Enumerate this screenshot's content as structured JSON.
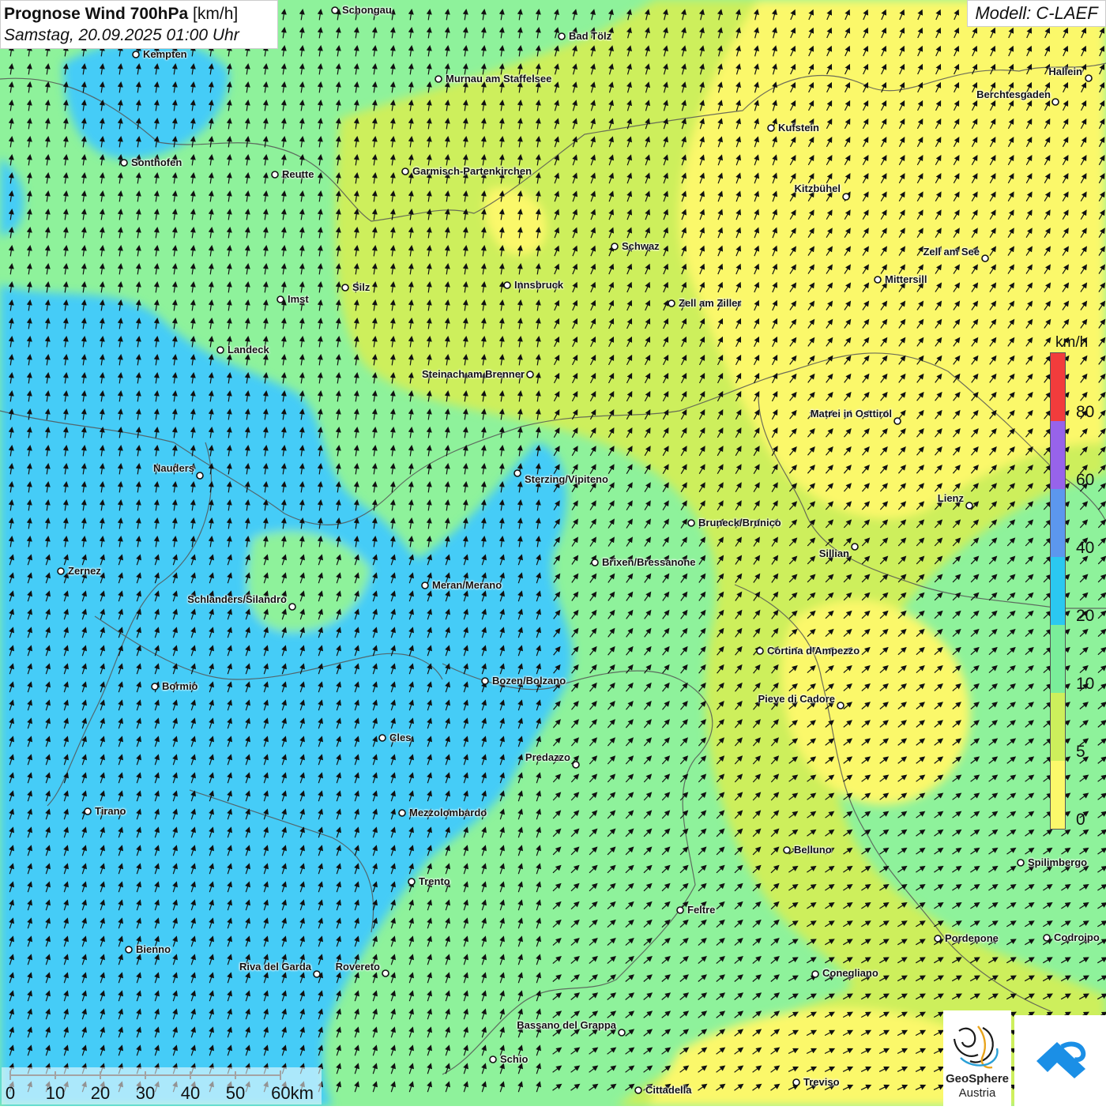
{
  "header": {
    "title_main": "Prognose Wind 700hPa",
    "title_unit": "[km/h]",
    "date_line": "Samstag, 20.09.2025 01:00 Uhr",
    "model": "Modell: C-LAEF"
  },
  "legend": {
    "unit": "km/h",
    "ticks": [
      "0",
      "5",
      "10",
      "20",
      "40",
      "60",
      "80"
    ],
    "colors": [
      "#fbf86b",
      "#cdef5c",
      "#7aed9a",
      "#2bc8f0",
      "#5c97ee",
      "#9763ea",
      "#f23c3c"
    ]
  },
  "scale_bar": {
    "labels": [
      "0",
      "10",
      "20",
      "30",
      "40",
      "50",
      "60km"
    ]
  },
  "logos": {
    "geosphere_line1": "GeoSphere",
    "geosphere_line2": "Austria"
  },
  "map_colors": {
    "low_0_5": "#fbf86b",
    "5_10": "#cdef5c",
    "10_20": "#8ef29b",
    "20_40": "#45ccf7",
    "border": "#555555"
  },
  "cities": [
    "Schongau",
    "Bad Tölz",
    "Kempten",
    "Murnau am Staffelsee",
    "Hallein",
    "Berchtesgaden",
    "Kufstein",
    "Sonthofen",
    "Reutte",
    "Garmisch-Partenkirchen",
    "Kitzbühel",
    "Schwaz",
    "Zell am See",
    "Mittersill",
    "Innsbruck",
    "Silz",
    "Imst",
    "Zell am Ziller",
    "Landeck",
    "Steinach am Brenner",
    "Matrei in Osttirol",
    "Nauders",
    "Sterzing/Vipiteno",
    "Lienz",
    "Bruneck/Brunico",
    "Sillian",
    "Brixen/Bressanone",
    "Zernez",
    "Meran/Merano",
    "Schlanders/Silandro",
    "Cortina d'Ampezzo",
    "Bozen/Bolzano",
    "Bormio",
    "Pieve di Cadore",
    "Cles",
    "Predazzo",
    "Tirano",
    "Mezzolombardo",
    "Belluno",
    "Spilimbergo",
    "Trento",
    "Feltre",
    "Pordenone",
    "Codroipo",
    "Bienno",
    "Riva del Garda",
    "Rovereto",
    "Conegliano",
    "Bassano del Grappa",
    "Schio",
    "Treviso",
    "Cittadella"
  ]
}
